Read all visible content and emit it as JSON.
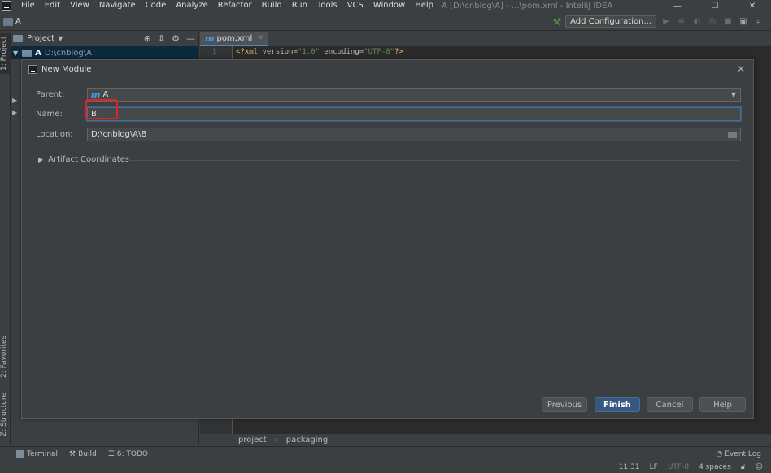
{
  "menubar": {
    "items": [
      "File",
      "Edit",
      "View",
      "Navigate",
      "Code",
      "Analyze",
      "Refactor",
      "Build",
      "Run",
      "Tools",
      "VCS",
      "Window",
      "Help"
    ],
    "window_title": "A [D:\\cnblog\\A] - ...\\pom.xml - IntelliJ IDEA",
    "controls": [
      "—",
      "☐",
      "✕"
    ]
  },
  "navbar": {
    "project": "A",
    "add_configuration": "Add Configuration..."
  },
  "left_strip": {
    "project_tab": "1: Project",
    "favorites_tab": "2: Favorites",
    "structure_tab": "Z: Structure"
  },
  "project_panel": {
    "title": "Project",
    "root_name": "A",
    "root_path": "D:\\cnblog\\A"
  },
  "editor": {
    "tab_label": "pom.xml",
    "line_number": "1",
    "code": {
      "open": "<?xml ",
      "version_attr": "version=",
      "version_val": "\"1.0\"",
      "encoding_attr": " encoding=",
      "encoding_val": "\"UTF-8\"",
      "close": "?>"
    },
    "breadcrumbs": [
      "project",
      "packaging"
    ]
  },
  "dialog": {
    "title": "New Module",
    "parent_label": "Parent:",
    "parent_value": "A",
    "name_label": "Name:",
    "name_value": "B",
    "location_label": "Location:",
    "location_value": "D:\\cnblog\\A\\B",
    "artifact_coordinates": "Artifact Coordinates",
    "buttons": {
      "previous": "Previous",
      "finish": "Finish",
      "cancel": "Cancel",
      "help": "Help"
    }
  },
  "bottom_tools": {
    "terminal": "Terminal",
    "build": "Build",
    "todo": "6: TODO",
    "event_log": "Event Log"
  },
  "status": {
    "position": "11:31",
    "line_sep": "LF",
    "encoding": "UTF-8",
    "indent": "4 spaces"
  },
  "colors": {
    "accent": "#365880",
    "highlight": "#e12326",
    "background": "#3c3f41"
  }
}
